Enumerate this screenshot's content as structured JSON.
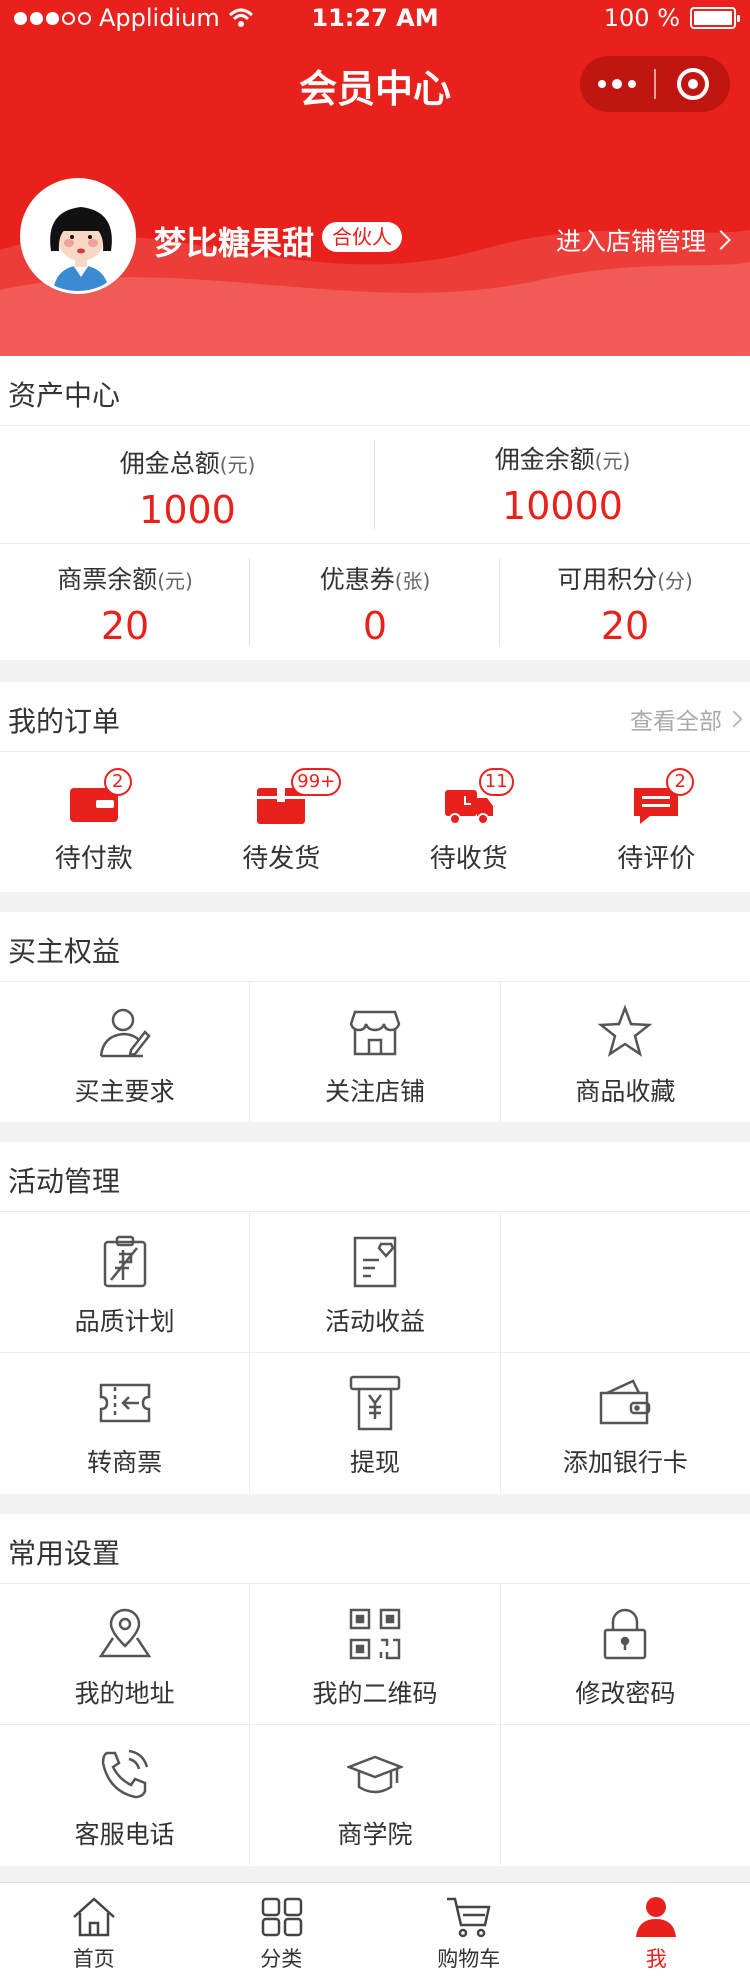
{
  "status_bar": {
    "carrier": "Applidium",
    "time": "11:27 AM",
    "battery": "100 %"
  },
  "nav": {
    "title": "会员中心"
  },
  "user": {
    "name": "梦比糖果甜",
    "badge": "合伙人",
    "store_link": "进入店铺管理"
  },
  "assets": {
    "title": "资产中心",
    "top": [
      {
        "label": "佣金总额",
        "unit": "(元)",
        "value": "1000"
      },
      {
        "label": "佣金余额",
        "unit": "(元)",
        "value": "10000"
      }
    ],
    "bottom": [
      {
        "label": "商票余额",
        "unit": "(元)",
        "value": "20"
      },
      {
        "label": "优惠券",
        "unit": "(张)",
        "value": "0"
      },
      {
        "label": "可用积分",
        "unit": "(分)",
        "value": "20"
      }
    ]
  },
  "orders": {
    "title": "我的订单",
    "more": "查看全部",
    "items": [
      {
        "label": "待付款",
        "badge": "2",
        "icon": "wallet-icon"
      },
      {
        "label": "待发货",
        "badge": "99+",
        "icon": "package-icon"
      },
      {
        "label": "待收货",
        "badge": "11",
        "icon": "truck-icon"
      },
      {
        "label": "待评价",
        "badge": "2",
        "icon": "comment-icon"
      }
    ]
  },
  "buyer": {
    "title": "买主权益",
    "items": [
      {
        "label": "买主要求",
        "icon": "user-edit-icon"
      },
      {
        "label": "关注店铺",
        "icon": "store-icon"
      },
      {
        "label": "商品收藏",
        "icon": "star-icon"
      }
    ]
  },
  "activity": {
    "title": "活动管理",
    "items": [
      {
        "label": "品质计划",
        "icon": "quality-plan-icon"
      },
      {
        "label": "活动收益",
        "icon": "activity-income-icon"
      },
      {
        "label": "转商票",
        "icon": "transfer-ticket-icon"
      },
      {
        "label": "提现",
        "icon": "withdraw-icon"
      },
      {
        "label": "添加银行卡",
        "icon": "bank-card-icon"
      }
    ]
  },
  "settings": {
    "title": "常用设置",
    "items": [
      {
        "label": "我的地址",
        "icon": "location-icon"
      },
      {
        "label": "我的二维码",
        "icon": "qr-code-icon"
      },
      {
        "label": "修改密码",
        "icon": "lock-icon"
      },
      {
        "label": "客服电话",
        "icon": "phone-icon"
      },
      {
        "label": "商学院",
        "icon": "graduation-cap-icon"
      }
    ]
  },
  "tabbar": {
    "items": [
      {
        "label": "首页",
        "icon": "home-icon"
      },
      {
        "label": "分类",
        "icon": "category-icon"
      },
      {
        "label": "购物车",
        "icon": "cart-icon"
      },
      {
        "label": "我",
        "icon": "user-icon",
        "active": true
      }
    ]
  },
  "colors": {
    "primary": "#e8211c",
    "text": "#333333",
    "muted": "#aaaaaa",
    "background": "#f2f2f2"
  }
}
